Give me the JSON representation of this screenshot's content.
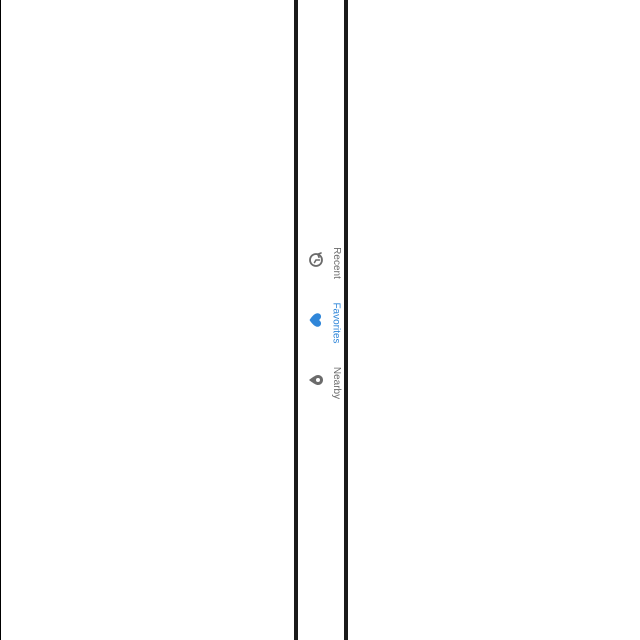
{
  "tabbar": {
    "tabs": [
      {
        "label": "Recent",
        "icon": "history-icon",
        "active": false
      },
      {
        "label": "Favorites",
        "icon": "heart-icon",
        "active": true
      },
      {
        "label": "Nearby",
        "icon": "location-pin-icon",
        "active": false
      }
    ]
  },
  "colors": {
    "active": "#2f86d9",
    "inactive": "#6b6b6b",
    "frame": "#1a1a1a",
    "background": "#ffffff"
  }
}
